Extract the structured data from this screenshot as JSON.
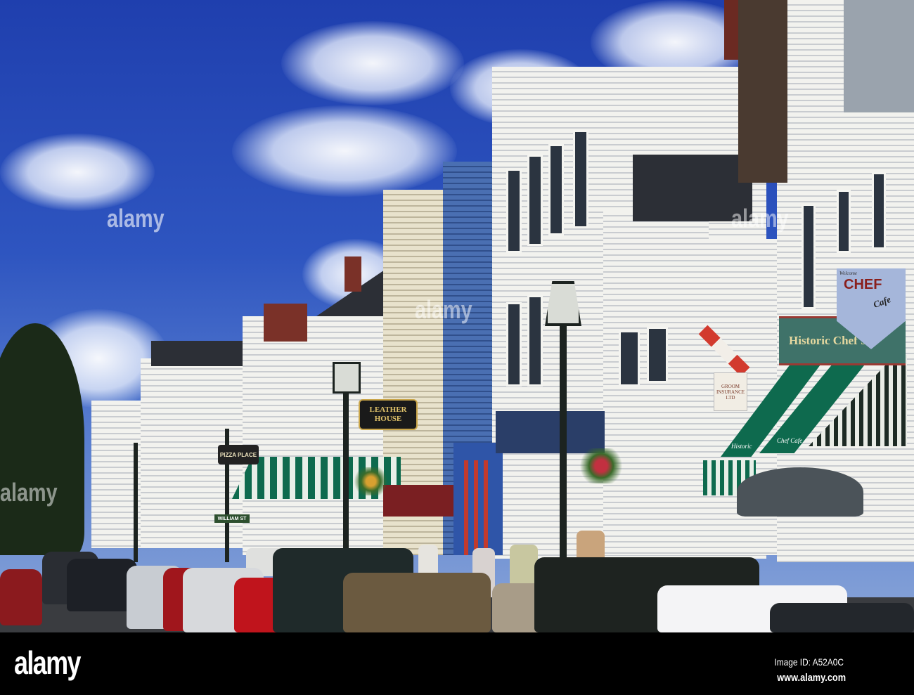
{
  "photo": {
    "signs": {
      "leather_house": "LEATHER HOUSE",
      "pizza_place": "PIZZA PLACE",
      "william_st": "WILLIAM ST",
      "chef_welcome": "Welcome",
      "chef_main": "CHEF",
      "chef_cafe": "Cafe",
      "historic_chefs": "Historic Chef's",
      "groom_insurance": "GROOM INSURANCE LTD",
      "awning_left": "Historic",
      "awning_mid": "Chef Cafe"
    },
    "watermark": "alamy",
    "colors": {
      "sky": "#2e55c0",
      "awning_green": "#0e6a4e",
      "chef_red": "#8a1f1c"
    }
  },
  "footer": {
    "logo": "alamy",
    "image_id": "Image ID: A52A0C",
    "url": "www.alamy.com"
  }
}
